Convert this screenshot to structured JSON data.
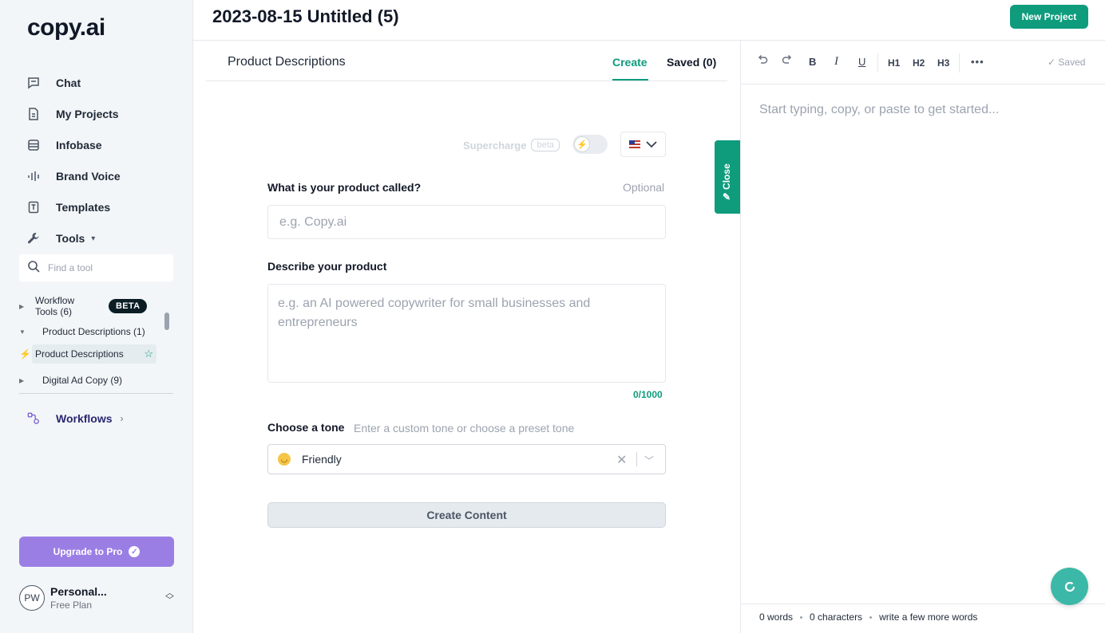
{
  "brand": {
    "logo": "copy.ai"
  },
  "sidebar": {
    "nav": [
      {
        "label": "Chat",
        "icon": "chat-icon"
      },
      {
        "label": "My Projects",
        "icon": "document-icon"
      },
      {
        "label": "Infobase",
        "icon": "database-icon"
      },
      {
        "label": "Brand Voice",
        "icon": "soundwave-icon"
      },
      {
        "label": "Templates",
        "icon": "template-icon"
      },
      {
        "label": "Tools",
        "icon": "wrench-icon"
      }
    ],
    "tool_search_placeholder": "Find a tool",
    "tree": [
      {
        "label": "Workflow Tools (6)",
        "badge": "BETA"
      },
      {
        "label": "Product Descriptions (1)"
      },
      {
        "label": "Product Descriptions"
      },
      {
        "label": "Digital Ad Copy (9)"
      }
    ],
    "workflows_label": "Workflows",
    "upgrade_label": "Upgrade to Pro",
    "account": {
      "initials": "PW",
      "name": "Personal...",
      "plan": "Free Plan"
    }
  },
  "header": {
    "doc_title": "2023-08-15 Untitled (5)",
    "new_project_label": "New Project"
  },
  "panel": {
    "title": "Product Descriptions",
    "tabs": {
      "create": "Create",
      "saved": "Saved (0)"
    },
    "supercharge_label": "Supercharge",
    "supercharge_badge": "beta",
    "product_name": {
      "label": "What is your product called?",
      "optional": "Optional",
      "placeholder": "e.g. Copy.ai",
      "value": ""
    },
    "product_desc": {
      "label": "Describe your product",
      "placeholder": "e.g. an AI powered copywriter for small businesses and entrepreneurs",
      "value": "",
      "counter": "0/1000"
    },
    "tone": {
      "label": "Choose a tone",
      "hint": "Enter a custom tone or choose a preset tone",
      "value": "Friendly"
    },
    "create_button": "Create Content",
    "close_label": "Close"
  },
  "editor": {
    "toolbar": {
      "bold": "B",
      "italic": "I",
      "underline": "U",
      "h1": "H1",
      "h2": "H2",
      "h3": "H3",
      "more": "•••",
      "saved": "Saved"
    },
    "placeholder": "Start typing, copy, or paste to get started...",
    "status": {
      "words": "0 words",
      "characters": "0 characters",
      "hint": "write a few more words"
    }
  },
  "colors": {
    "accent": "#0e9c7d",
    "upgrade": "#9b7ee4",
    "fab": "#3cb8a8"
  }
}
